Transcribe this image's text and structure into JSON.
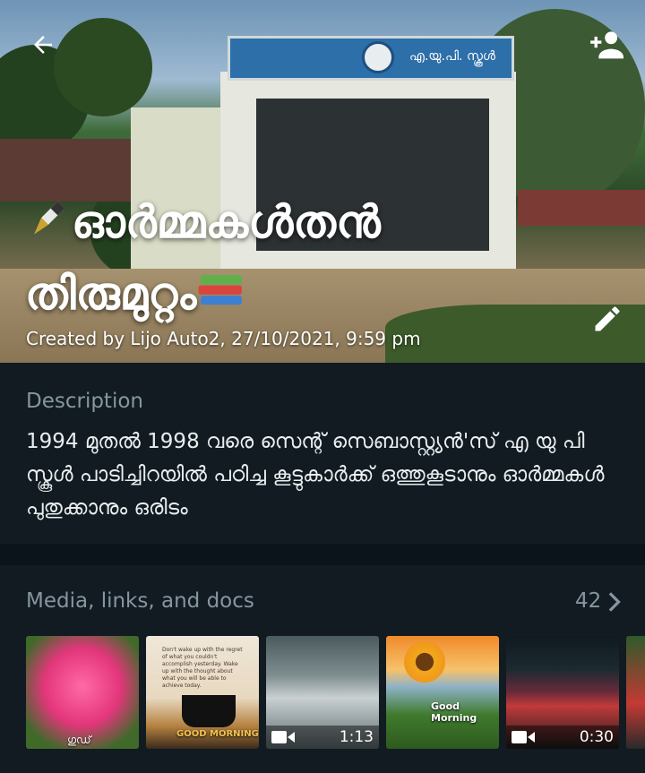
{
  "header": {
    "title": "🖋️ഓർമ്മകൾതൻ തിരുമുറ്റം📚",
    "title_line1": "ഓർമ്മകൾതൻ",
    "title_line2": "തിരുമുറ്റം",
    "created": "Created by Lijo Auto2, 27/10/2021, 9:59 pm",
    "sign_text": "എ.യു.പി. സ്കൂൾ"
  },
  "description": {
    "label": "Description",
    "text": "1994 മുതൽ 1998 വരെ സെന്റ് സെബാസ്റ്റ്യൻ'സ് എ യു പി സ്കൂൾ പാടിച്ചിറയിൽ  പഠിച്ച കൂട്ടുകാർക്ക് ഒത്തുകൂടാനും ഓർമ്മകൾ പുതുക്കാനും ഒരിടം"
  },
  "media": {
    "label": "Media, links, and docs",
    "count": "42",
    "thumbs": [
      {
        "kind": "image",
        "caption": "ഗുഡ്"
      },
      {
        "kind": "image",
        "caption": "Don't wake up with the regret of what you couldn't accomplish yesterday. Wake up with the thought about what you will be able to achieve today.",
        "caption2": "GOOD MORNING"
      },
      {
        "kind": "video",
        "duration": "1:13"
      },
      {
        "kind": "image",
        "caption": "Good Morning"
      },
      {
        "kind": "video",
        "duration": "0:30"
      },
      {
        "kind": "image",
        "caption": ""
      }
    ]
  },
  "colors": {
    "background": "#0b141a",
    "panel": "#111b21",
    "muted_text": "#8696a0",
    "primary_text": "#e9edef"
  },
  "icons": [
    "back-arrow-icon",
    "add-person-icon",
    "edit-pencil-icon",
    "chevron-right-icon",
    "videocam-icon"
  ]
}
